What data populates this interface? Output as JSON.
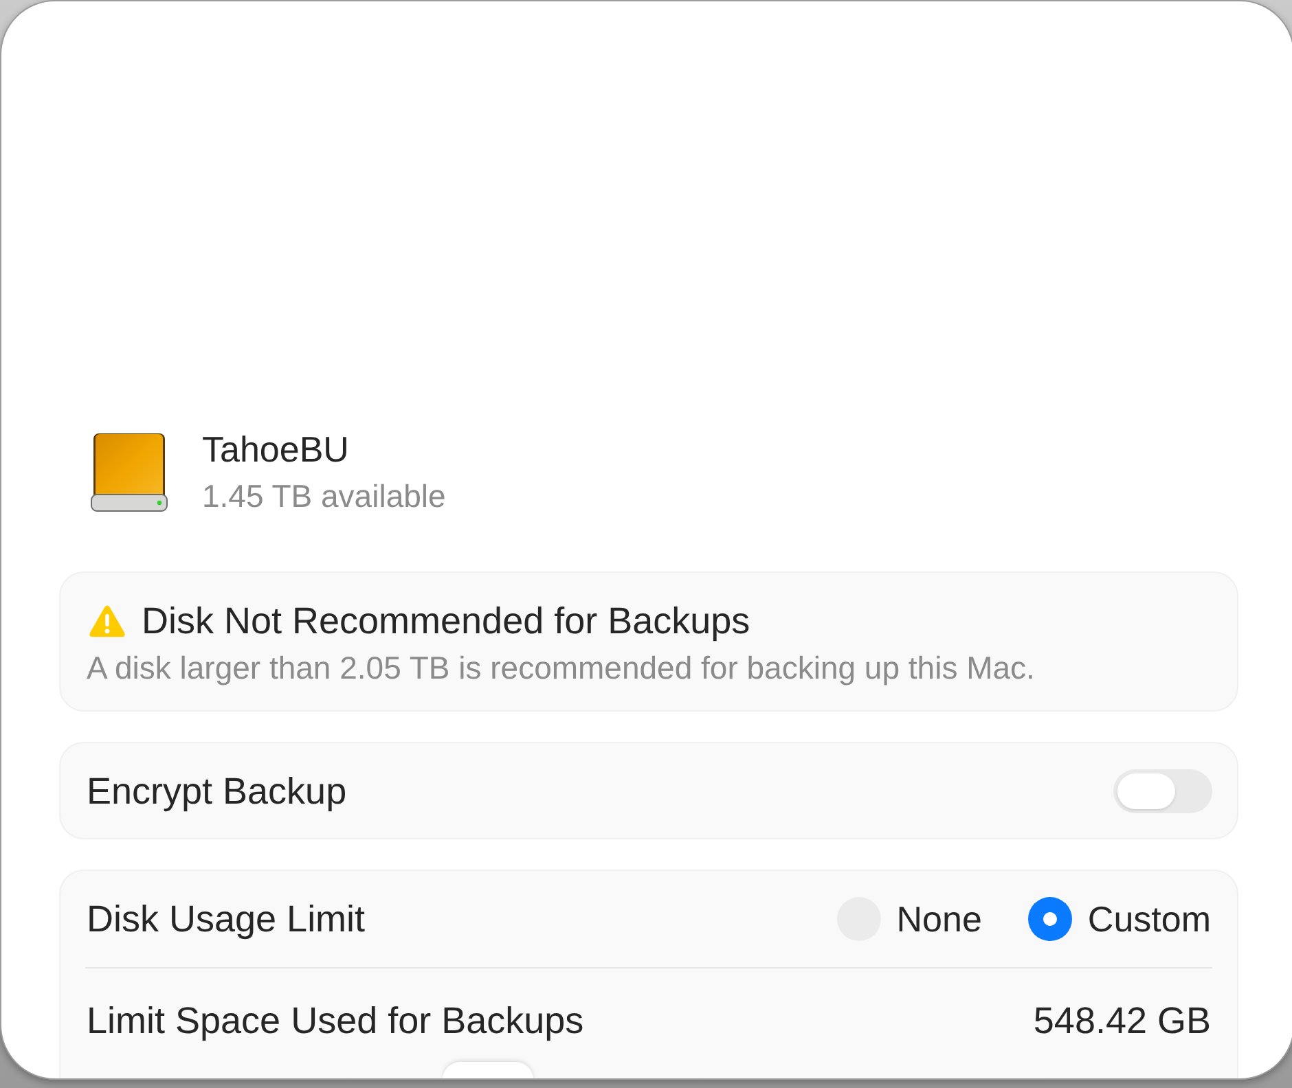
{
  "disk": {
    "name": "TahoeBU",
    "available": "1.45 TB available"
  },
  "warning": {
    "title": "Disk Not Recommended for Backups",
    "message": "A disk larger than 2.05 TB is recommended for backing up this Mac."
  },
  "encrypt": {
    "label": "Encrypt Backup",
    "on": false
  },
  "usage": {
    "label": "Disk Usage Limit",
    "options": [
      {
        "label": "None",
        "selected": false
      },
      {
        "label": "Custom",
        "selected": true
      }
    ],
    "limit_label": "Limit Space Used for Backups",
    "limit_value": "548.42 GB",
    "slider": {
      "level": 0.345
    }
  }
}
